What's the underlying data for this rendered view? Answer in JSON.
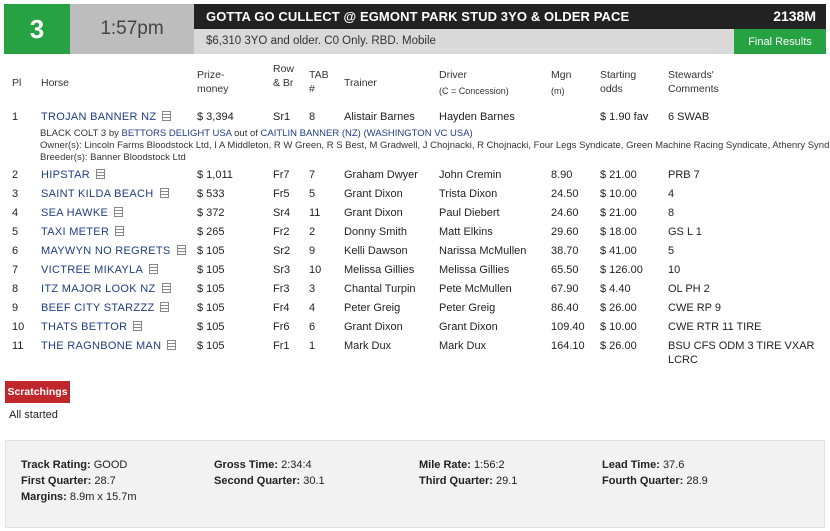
{
  "race": {
    "number": "3",
    "time": "1:57pm",
    "name": "GOTTA GO CULLECT @ EGMONT PARK STUD 3YO & OLDER PACE",
    "distance": "2138M",
    "info": "$6,310 3YO and older. C0 Only. RBD. Mobile",
    "status_button": "Final Results"
  },
  "columns": {
    "pl": "Pl",
    "horse": "Horse",
    "prize": "Prize-money",
    "row": "Row & Br",
    "tab": "TAB #",
    "trainer": "Trainer",
    "driver": "Driver",
    "driver_note": "(C = Concession)",
    "mgn": "Mgn",
    "mgn_unit": "(m)",
    "odds": "Starting odds",
    "stewards": "Stewards' Comments"
  },
  "runners": [
    {
      "pl": "1",
      "horse": "TROJAN BANNER NZ",
      "prize": "$ 3,394",
      "row": "Sr1",
      "tab": "8",
      "trainer": "Alistair Barnes",
      "driver": "Hayden Barnes",
      "mgn": "",
      "odds": "$ 1.90 fav",
      "comments": "6 SWAB",
      "comments2": ""
    },
    {
      "pl": "2",
      "horse": "HIPSTAR",
      "prize": "$ 1,011",
      "row": "Fr7",
      "tab": "7",
      "trainer": "Graham Dwyer",
      "driver": "John Cremin",
      "mgn": "8.90",
      "odds": "$ 21.00",
      "comments": "PRB 7",
      "comments2": ""
    },
    {
      "pl": "3",
      "horse": "SAINT KILDA BEACH",
      "prize": "$ 533",
      "row": "Fr5",
      "tab": "5",
      "trainer": "Grant Dixon",
      "driver": "Trista Dixon",
      "mgn": "24.50",
      "odds": "$ 10.00",
      "comments": "4",
      "comments2": ""
    },
    {
      "pl": "4",
      "horse": "SEA HAWKE",
      "prize": "$ 372",
      "row": "Sr4",
      "tab": "11",
      "trainer": "Grant Dixon",
      "driver": "Paul Diebert",
      "mgn": "24.60",
      "odds": "$ 21.00",
      "comments": "8",
      "comments2": ""
    },
    {
      "pl": "5",
      "horse": "TAXI METER",
      "prize": "$ 265",
      "row": "Fr2",
      "tab": "2",
      "trainer": "Donny Smith",
      "driver": "Matt Elkins",
      "mgn": "29.60",
      "odds": "$ 18.00",
      "comments": "GS L 1",
      "comments2": ""
    },
    {
      "pl": "6",
      "horse": "MAYWYN NO REGRETS",
      "prize": "$ 105",
      "row": "Sr2",
      "tab": "9",
      "trainer": "Kelli Dawson",
      "driver": "Narissa McMullen",
      "mgn": "38.70",
      "odds": "$ 41.00",
      "comments": "5",
      "comments2": ""
    },
    {
      "pl": "7",
      "horse": "VICTREE MIKAYLA",
      "prize": "$ 105",
      "row": "Sr3",
      "tab": "10",
      "trainer": "Melissa Gillies",
      "driver": "Melissa Gillies",
      "mgn": "65.50",
      "odds": "$ 126.00",
      "comments": "10",
      "comments2": ""
    },
    {
      "pl": "8",
      "horse": "ITZ MAJOR LOOK NZ",
      "prize": "$ 105",
      "row": "Fr3",
      "tab": "3",
      "trainer": "Chantal Turpin",
      "driver": "Pete McMullen",
      "mgn": "67.90",
      "odds": "$ 4.40",
      "comments": "OL PH 2",
      "comments2": ""
    },
    {
      "pl": "9",
      "horse": "BEEF CITY STARZZZ",
      "prize": "$ 105",
      "row": "Fr4",
      "tab": "4",
      "trainer": "Peter Greig",
      "driver": "Peter Greig",
      "mgn": "86.40",
      "odds": "$ 26.00",
      "comments": "CWE RP 9",
      "comments2": ""
    },
    {
      "pl": "10",
      "horse": "THATS BETTOR",
      "prize": "$ 105",
      "row": "Fr6",
      "tab": "6",
      "trainer": "Grant Dixon",
      "driver": "Grant Dixon",
      "mgn": "109.40",
      "odds": "$ 10.00",
      "comments": "CWE RTR 11 TIRE",
      "comments2": ""
    },
    {
      "pl": "11",
      "horse": "THE RAGNBONE MAN",
      "prize": "$ 105",
      "row": "Fr1",
      "tab": "1",
      "trainer": "Mark Dux",
      "driver": "Mark Dux",
      "mgn": "164.10",
      "odds": "$ 26.00",
      "comments": "BSU CFS ODM 3 TIRE VXAR",
      "comments2": "LCRC"
    }
  ],
  "winner_breeding": {
    "desc": "BLACK COLT 3 by",
    "sire": "BETTORS DELIGHT USA",
    "out_of": "out of",
    "dam": "CAITLIN BANNER (NZ) (WASHINGTON VC USA)",
    "owners": "Owner(s): Lincoln Farms Bloodstock Ltd, I A Middleton, R W Green, R S Best, M Gradwell, J Chojnacki, R Chojnacki, Four Legs Syndicate, Green Machine Racing Syndicate, Athenry Syndicate",
    "breeders": "Breeder(s): Banner Bloodstock Ltd"
  },
  "scratchings": {
    "label": "Scratchings",
    "text": "All started"
  },
  "stats": {
    "track_rating_label": "Track Rating:",
    "track_rating": "GOOD",
    "gross_time_label": "Gross Time:",
    "gross_time": "2:34:4",
    "mile_rate_label": "Mile Rate:",
    "mile_rate": "1:56:2",
    "lead_time_label": "Lead Time:",
    "lead_time": "37.6",
    "first_q_label": "First Quarter:",
    "first_q": "28.7",
    "second_q_label": "Second Quarter:",
    "second_q": "30.1",
    "third_q_label": "Third Quarter:",
    "third_q": "29.1",
    "fourth_q_label": "Fourth Quarter:",
    "fourth_q": "28.9",
    "margins_label": "Margins:",
    "margins": "8.9m x 15.7m"
  }
}
